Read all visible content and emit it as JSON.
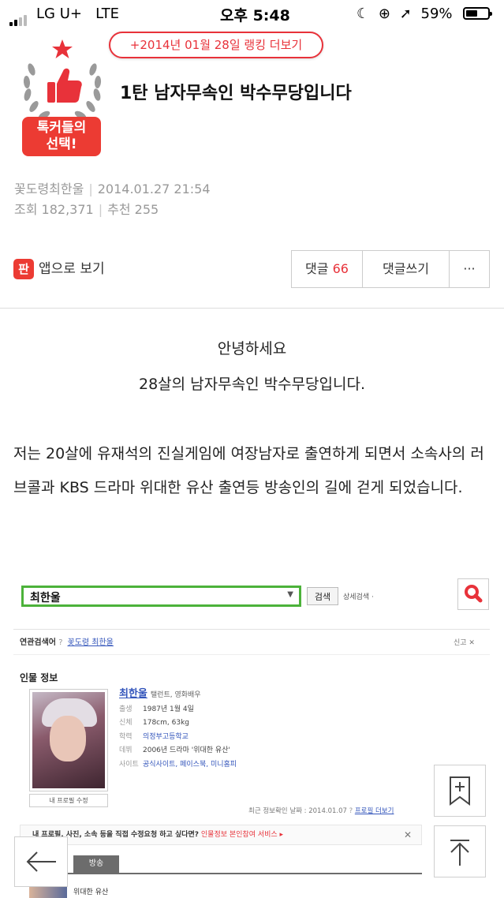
{
  "status_bar": {
    "carrier": "LG U+",
    "network": "LTE",
    "time": "오후 5:48",
    "battery": "59%",
    "icons": [
      "signal-icon",
      "moon-icon",
      "rotation-lock-icon",
      "location-icon",
      "battery-icon"
    ]
  },
  "ranking_link": "+2014년 01월 28일 랭킹 더보기",
  "badge": {
    "line1": "톡커들의",
    "line2": "선택!",
    "icon": "thumbs-up-icon"
  },
  "post": {
    "title": "1탄 남자무속인 박수무당입니다",
    "author": "꽃도령최한울",
    "date": "2014.01.27 21:54",
    "views_label": "조회",
    "views": "182,371",
    "likes_label": "추천",
    "likes": "255"
  },
  "actions": {
    "app_icon_text": "판",
    "app_view": "앱으로 보기",
    "comments_label": "댓글",
    "comments_count": "66",
    "write_comment": "댓글쓰기",
    "more": "···"
  },
  "body": {
    "greeting1": "안녕하세요",
    "greeting2": "28살의 남자무속인 박수무당입니다.",
    "paragraph": "저는 20살에 유재석의 진실게임에 여장남자로 출연하게 되면서 소속사의 러브콜과 KBS 드라마 위대한 유산 출연등 방송인의 길에 걷게 되었습니다."
  },
  "embedded": {
    "search_value": "최한울",
    "search_button": "검색",
    "advanced": "상세검색 ·",
    "related_label": "연관검색어",
    "related_link": "꽃도령 최한울",
    "related_right": "신고  ✕",
    "person_heading": "인물 정보",
    "name": "최한울",
    "job": "탤런트, 영화배우",
    "rows": [
      {
        "k": "출생",
        "v": "1987년 1월 4일"
      },
      {
        "k": "신체",
        "v": "178cm, 63kg"
      },
      {
        "k": "학력",
        "v": "의정부고등학교"
      },
      {
        "k": "데뷔",
        "v": "2006년 드라마 '위대한 유산'"
      },
      {
        "k": "사이트",
        "v": "공식사이트, 페이스북, 미니홈피"
      }
    ],
    "edit_profile": "내 프로필 수정",
    "updated": "최근 정보확인 날짜 : 2014.01.07",
    "profile_more": "프로필 더보기",
    "banner": "내 프로필, 사진, 소속 등을 직접 수정요청 하고 싶다면?",
    "banner_link": "인물정보 본인참여 서비스 ▸",
    "banner_close": "✕",
    "tab": "방송",
    "program": "위대한 유산"
  },
  "floating": {
    "scrap": "bookmark-add-icon",
    "top": "arrow-up-icon",
    "back": "arrow-left-icon"
  }
}
